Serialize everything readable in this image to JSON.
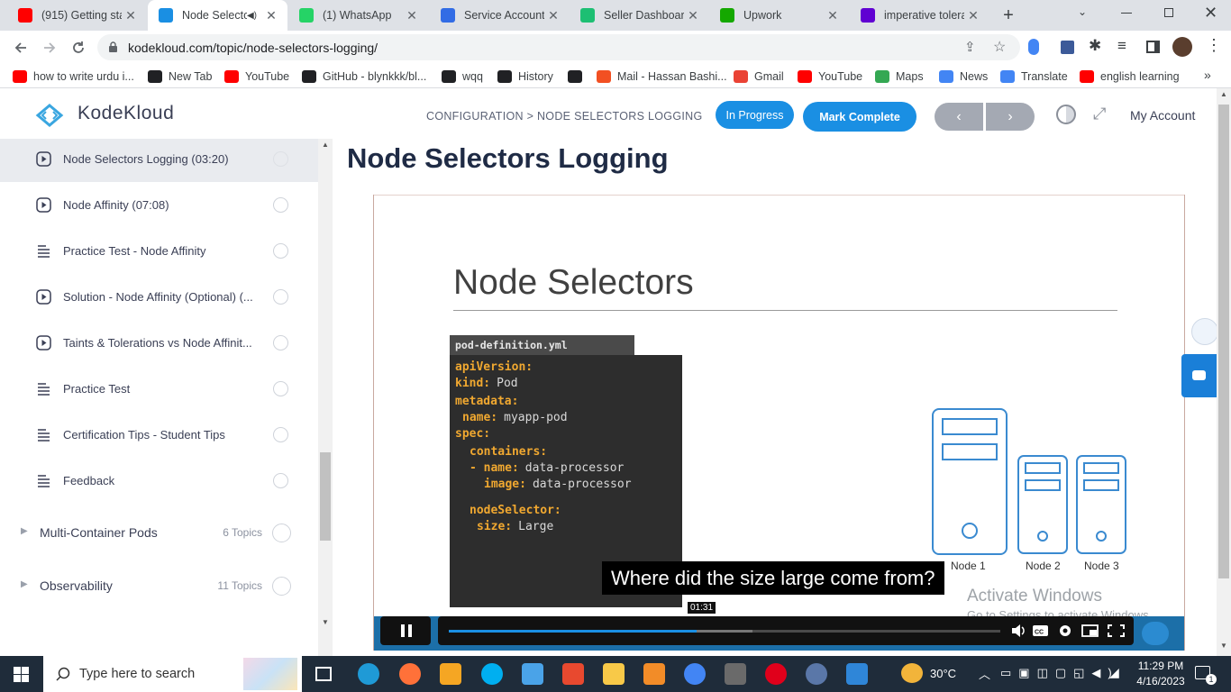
{
  "browser": {
    "tabs": [
      {
        "title": "(915) Getting star",
        "icon": "youtube-icon",
        "color": "#ff0000"
      },
      {
        "title": "Node Selecto",
        "icon": "kodekloud-icon",
        "color": "#1a8fe3",
        "active": true
      },
      {
        "title": "(1) WhatsApp",
        "icon": "whatsapp-icon",
        "color": "#25d366"
      },
      {
        "title": "Service Account",
        "icon": "kubernetes-icon",
        "color": "#326ce5"
      },
      {
        "title": "Seller Dashboard",
        "icon": "fiverr-icon",
        "color": "#1dbf73"
      },
      {
        "title": "Upwork",
        "icon": "upwork-icon",
        "color": "#14a800"
      },
      {
        "title": "imperative tolera",
        "icon": "yahoo-icon",
        "color": "#6001d2"
      }
    ],
    "url": "kodekloud.com/topic/node-selectors-logging/",
    "bookmarks": [
      {
        "label": "how to write urdu i...",
        "icon": "youtube-icon",
        "color": "#ff0000"
      },
      {
        "label": "New Tab",
        "icon": "globe-icon",
        "color": "#202124"
      },
      {
        "label": "YouTube",
        "icon": "youtube-icon",
        "color": "#ff0000"
      },
      {
        "label": "GitHub - blynkkk/bl...",
        "icon": "github-icon",
        "color": "#202124"
      },
      {
        "label": "wqq",
        "icon": "download-icon",
        "color": "#202124"
      },
      {
        "label": "History",
        "icon": "history-icon",
        "color": "#202124"
      },
      {
        "label": "",
        "icon": "globe-icon",
        "color": "#202124"
      },
      {
        "label": "Mail - Hassan Bashi...",
        "icon": "microsoft-icon",
        "color": "#f25022"
      },
      {
        "label": "Gmail",
        "icon": "gmail-icon",
        "color": "#ea4335"
      },
      {
        "label": "YouTube",
        "icon": "youtube-icon",
        "color": "#ff0000"
      },
      {
        "label": "Maps",
        "icon": "maps-icon",
        "color": "#34a853"
      },
      {
        "label": "News",
        "icon": "news-icon",
        "color": "#4285f4"
      },
      {
        "label": "Translate",
        "icon": "translate-icon",
        "color": "#4285f4"
      },
      {
        "label": "english learning",
        "icon": "youtube-icon",
        "color": "#ff0000"
      }
    ]
  },
  "header": {
    "logo": "KodeKloud",
    "breadcrumb": "CONFIGURATION > NODE SELECTORS LOGGING",
    "status": "In Progress",
    "mark_complete": "Mark Complete",
    "prev": "‹",
    "next": "›",
    "account": "My Account"
  },
  "sidebar": {
    "lessons": [
      {
        "label": "Node Selectors Logging (03:20)",
        "type": "video",
        "active": true
      },
      {
        "label": "Node Affinity (07:08)",
        "type": "video"
      },
      {
        "label": "Practice Test - Node Affinity",
        "type": "text"
      },
      {
        "label": "Solution - Node Affinity (Optional) (...",
        "type": "video"
      },
      {
        "label": "Taints & Tolerations vs Node Affinit...",
        "type": "video"
      },
      {
        "label": "Practice Test",
        "type": "text"
      },
      {
        "label": "Certification Tips - Student Tips",
        "type": "text"
      },
      {
        "label": "Feedback",
        "type": "text"
      }
    ],
    "sections": [
      {
        "label": "Multi-Container Pods",
        "count": "6 Topics"
      },
      {
        "label": "Observability",
        "count": "11 Topics"
      }
    ]
  },
  "content": {
    "title": "Node Selectors Logging",
    "slide": {
      "heading": "Node Selectors",
      "file_tab": "pod-definition.yml",
      "code": [
        {
          "key": "apiVersion:",
          "val": "",
          "indent": 0
        },
        {
          "key": "kind:",
          "val": "Pod",
          "indent": 0
        },
        {
          "key": "metadata:",
          "val": "",
          "indent": 0
        },
        {
          "key": "name:",
          "val": "myapp-pod",
          "indent": 1
        },
        {
          "key": "spec:",
          "val": "",
          "indent": 0
        },
        {
          "key": "containers:",
          "val": "",
          "indent": 2
        },
        {
          "key": "- name:",
          "val": "data-processor",
          "indent": 2
        },
        {
          "key": "image:",
          "val": "data-processor",
          "indent": 4
        },
        {
          "key": "nodeSelector:",
          "val": "",
          "indent": 2
        },
        {
          "key": "size:",
          "val": "Large",
          "indent": 3
        }
      ],
      "nodes": [
        "Node 1",
        "Node 2",
        "Node 3"
      ]
    },
    "caption": "Where did the size large come from?",
    "watermark_line1": "Activate Windows",
    "watermark_line2": "Go to Settings to activate Windows.",
    "player": {
      "time_tooltip": "01:31",
      "progress_fraction": 0.45,
      "buffered_fraction": 0.55
    }
  },
  "taskbar": {
    "search_placeholder": "Type here to search",
    "temperature": "30°C",
    "time": "11:29 PM",
    "date": "4/16/2023",
    "notification_count": "1"
  }
}
